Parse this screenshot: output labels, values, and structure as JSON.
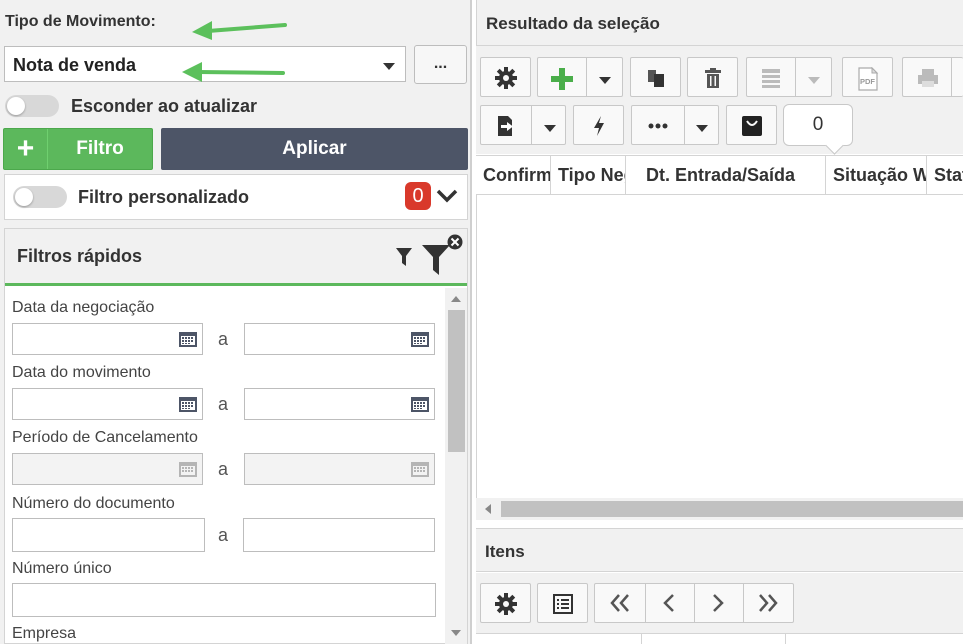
{
  "filters_panel": {
    "tipo_movimento_label": "Tipo de Movimento:",
    "tipo_movimento_value": "Nota de venda",
    "more_button_label": "...",
    "hide_on_update_label": "Esconder ao atualizar",
    "filtro_button_label": "Filtro",
    "aplicar_button_label": "Aplicar",
    "custom_filter_label": "Filtro personalizado",
    "custom_filter_count": "0",
    "quick_filters_title": "Filtros rápidos",
    "range_separator": "a",
    "fields": [
      {
        "label": "Data da negociação"
      },
      {
        "label": "Data do movimento"
      },
      {
        "label": "Período de Cancelamento"
      },
      {
        "label": "Número do documento"
      },
      {
        "label": "Número único"
      },
      {
        "label": "Empresa"
      }
    ]
  },
  "results_panel": {
    "title": "Resultado da seleção",
    "record_count": "0",
    "columns": [
      "Confirmada",
      "Tipo Negociação",
      "Dt. Entrada/Saída",
      "Situação WMS",
      "Status"
    ],
    "toolbar_icons": [
      "gear-icon",
      "plus-icon",
      "copy-icon",
      "trash-icon",
      "list-icon",
      "pdf-icon",
      "print-icon",
      "export-icon",
      "lightning-icon",
      "more-icon",
      "bag-icon"
    ]
  },
  "items_panel": {
    "title": "Itens",
    "toolbar_icons": [
      "gear-icon",
      "table-icon",
      "first-page-icon",
      "prev-page-icon",
      "next-page-icon",
      "last-page-icon"
    ]
  },
  "colors": {
    "green": "#5cb85c",
    "dark_button": "#4d5567",
    "badge_red": "#d9392b",
    "annotation_arrow": "#5cc05c"
  }
}
